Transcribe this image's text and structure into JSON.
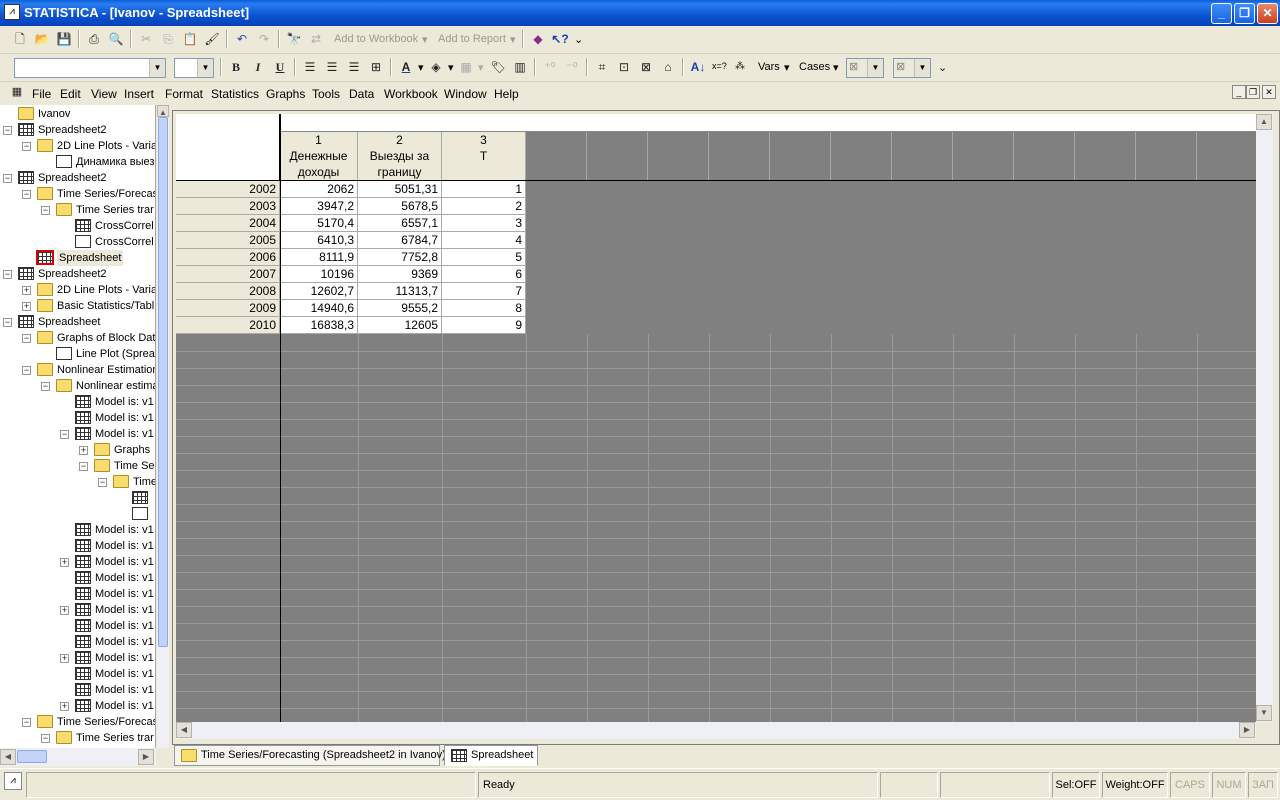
{
  "window": {
    "title": "STATISTICA - [Ivanov - Spreadsheet]",
    "app_icon": "statistica-icon",
    "controls": [
      "minimize",
      "maximize",
      "close"
    ]
  },
  "toolbar1": {
    "add_to_workbook": "Add to Workbook",
    "add_to_report": "Add to Report"
  },
  "toolbar2": {
    "font_name_value": "",
    "font_size_value": "",
    "bold": "B",
    "italic": "I",
    "underline": "U",
    "vars_label": "Vars",
    "cases_label": "Cases",
    "cell_spacer": "x=?"
  },
  "menu": [
    "File",
    "Edit",
    "View",
    "Insert",
    "Format",
    "Statistics",
    "Graphs",
    "Tools",
    "Data",
    "Workbook",
    "Window",
    "Help"
  ],
  "tree": [
    {
      "label": "Ivanov",
      "icon": "folder-icon",
      "level": 0,
      "exp": ""
    },
    {
      "label": "Spreadsheet2",
      "icon": "spreadsheet-icon",
      "level": 0,
      "exp": "-"
    },
    {
      "label": "2D Line Plots - Varia",
      "icon": "folder-icon",
      "level": 1,
      "exp": "-"
    },
    {
      "label": "Динамика выез",
      "icon": "graph-icon",
      "level": 2,
      "exp": ""
    },
    {
      "label": "Spreadsheet2",
      "icon": "spreadsheet-icon",
      "level": 0,
      "exp": "-"
    },
    {
      "label": "Time Series/Forecas",
      "icon": "folder-icon",
      "level": 1,
      "exp": "-"
    },
    {
      "label": "Time Series trar",
      "icon": "folder-icon",
      "level": 2,
      "exp": "-"
    },
    {
      "label": "CrossCorrel",
      "icon": "spreadsheet-icon",
      "level": 3,
      "exp": ""
    },
    {
      "label": "CrossCorrel",
      "icon": "graph-icon",
      "level": 3,
      "exp": ""
    },
    {
      "label": "Spreadsheet",
      "icon": "spreadsheet-selected-icon",
      "level": 1,
      "exp": ""
    },
    {
      "label": "Spreadsheet2",
      "icon": "spreadsheet-icon",
      "level": 0,
      "exp": "-"
    },
    {
      "label": "2D Line Plots - Varia",
      "icon": "folder-icon",
      "level": 1,
      "exp": "+"
    },
    {
      "label": "Basic Statistics/Tabl",
      "icon": "folder-icon",
      "level": 1,
      "exp": "+"
    },
    {
      "label": "Spreadsheet",
      "icon": "spreadsheet-icon",
      "level": 0,
      "exp": "-"
    },
    {
      "label": "Graphs of Block Dat",
      "icon": "folder-icon",
      "level": 1,
      "exp": "-"
    },
    {
      "label": "Line Plot (Sprea",
      "icon": "graph-icon",
      "level": 2,
      "exp": ""
    },
    {
      "label": "Nonlinear Estimation",
      "icon": "folder-icon",
      "level": 1,
      "exp": "-"
    },
    {
      "label": "Nonlinear estima",
      "icon": "folder-icon",
      "level": 2,
      "exp": "-"
    },
    {
      "label": "Model is: v1",
      "icon": "spreadsheet-icon",
      "level": 3,
      "exp": ""
    },
    {
      "label": "Model is: v1",
      "icon": "spreadsheet-icon",
      "level": 3,
      "exp": ""
    },
    {
      "label": "Model is: v1",
      "icon": "spreadsheet-icon",
      "level": 3,
      "exp": "-"
    },
    {
      "label": "Graphs",
      "icon": "folder-icon",
      "level": 4,
      "exp": "+"
    },
    {
      "label": "Time Se",
      "icon": "folder-icon",
      "level": 4,
      "exp": "-"
    },
    {
      "label": "Time",
      "icon": "folder-icon",
      "level": 5,
      "exp": "-"
    },
    {
      "label": "",
      "icon": "spreadsheet-icon",
      "level": 6,
      "exp": ""
    },
    {
      "label": "",
      "icon": "graph-icon",
      "level": 6,
      "exp": ""
    },
    {
      "label": "Model is: v1",
      "icon": "spreadsheet-icon",
      "level": 3,
      "exp": ""
    },
    {
      "label": "Model is: v1",
      "icon": "spreadsheet-icon",
      "level": 3,
      "exp": ""
    },
    {
      "label": "Model is: v1",
      "icon": "spreadsheet-icon",
      "level": 3,
      "exp": "+"
    },
    {
      "label": "Model is: v1",
      "icon": "spreadsheet-icon",
      "level": 3,
      "exp": ""
    },
    {
      "label": "Model is: v1",
      "icon": "spreadsheet-icon",
      "level": 3,
      "exp": ""
    },
    {
      "label": "Model is: v1",
      "icon": "spreadsheet-icon",
      "level": 3,
      "exp": "+"
    },
    {
      "label": "Model is: v1",
      "icon": "spreadsheet-icon",
      "level": 3,
      "exp": ""
    },
    {
      "label": "Model is: v1",
      "icon": "spreadsheet-icon",
      "level": 3,
      "exp": ""
    },
    {
      "label": "Model is: v1",
      "icon": "spreadsheet-icon",
      "level": 3,
      "exp": "+"
    },
    {
      "label": "Model is: v1",
      "icon": "spreadsheet-icon",
      "level": 3,
      "exp": ""
    },
    {
      "label": "Model is: v1",
      "icon": "spreadsheet-icon",
      "level": 3,
      "exp": ""
    },
    {
      "label": "Model is: v1",
      "icon": "spreadsheet-icon",
      "level": 3,
      "exp": "+"
    },
    {
      "label": "Time Series/Forecas",
      "icon": "folder-icon",
      "level": 1,
      "exp": "-"
    },
    {
      "label": "Time Series trar",
      "icon": "folder-icon",
      "level": 2,
      "exp": "-"
    }
  ],
  "spreadsheet": {
    "columns": [
      {
        "number": "1",
        "name_line1": "Денежные",
        "name_line2": "доходы"
      },
      {
        "number": "2",
        "name_line1": "Выезды за",
        "name_line2": "границу"
      },
      {
        "number": "3",
        "name_line1": "T",
        "name_line2": ""
      }
    ],
    "rows": [
      {
        "case": "2002",
        "values": [
          "2062",
          "5051,31",
          "1"
        ]
      },
      {
        "case": "2003",
        "values": [
          "3947,2",
          "5678,5",
          "2"
        ]
      },
      {
        "case": "2004",
        "values": [
          "5170,4",
          "6557,1",
          "3"
        ]
      },
      {
        "case": "2005",
        "values": [
          "6410,3",
          "6784,7",
          "4"
        ]
      },
      {
        "case": "2006",
        "values": [
          "8111,9",
          "7752,8",
          "5"
        ]
      },
      {
        "case": "2007",
        "values": [
          "10196",
          "9369",
          "6"
        ]
      },
      {
        "case": "2008",
        "values": [
          "12602,7",
          "11313,7",
          "7"
        ]
      },
      {
        "case": "2009",
        "values": [
          "14940,6",
          "9555,2",
          "8"
        ]
      },
      {
        "case": "2010",
        "values": [
          "16838,3",
          "12605",
          "9"
        ]
      }
    ]
  },
  "tabs": [
    {
      "label": "Time Series/Forecasting (Spreadsheet2 in Ivanov)",
      "icon": "folder-icon",
      "active": false
    },
    {
      "label": "Spreadsheet",
      "icon": "spreadsheet-icon",
      "active": true
    }
  ],
  "status": {
    "ready": "Ready",
    "sel": "Sel:OFF",
    "weight": "Weight:OFF",
    "caps": "CAPS",
    "num": "NUM",
    "zap": "ЗАП"
  }
}
